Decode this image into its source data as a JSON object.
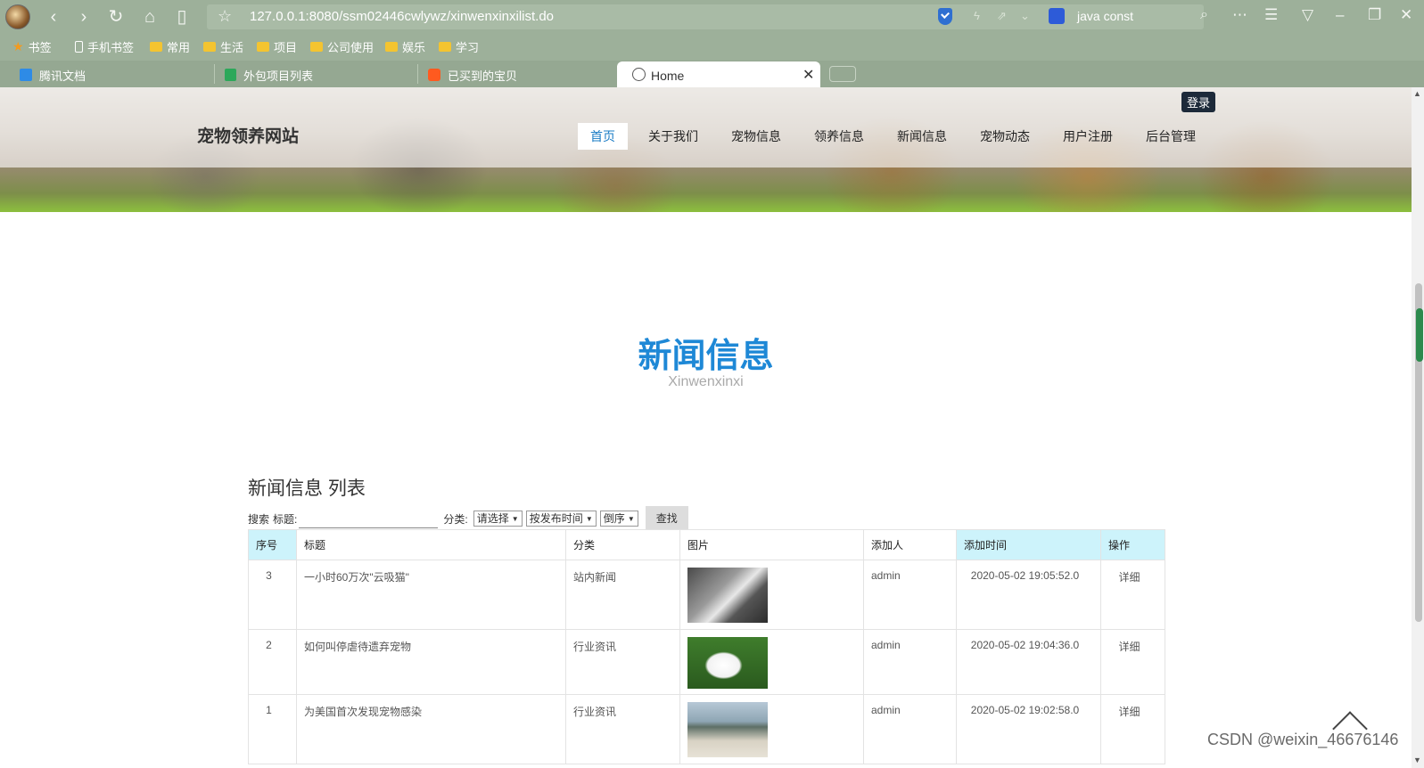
{
  "browser": {
    "url": "127.0.0.1:8080/ssm02446cwlywz/xinwenxinxilist.do",
    "search_text": "java const",
    "bookmarks": [
      "书签",
      "手机书签",
      "常用",
      "生活",
      "项目",
      "公司使用",
      "娱乐",
      "学习"
    ],
    "tabs": [
      "腾讯文档",
      "外包项目列表",
      "已买到的宝贝",
      "Home"
    ]
  },
  "site": {
    "title": "宠物领养网站",
    "login": "登录",
    "nav": [
      "首页",
      "关于我们",
      "宠物信息",
      "领养信息",
      "新闻信息",
      "宠物动态",
      "用户注册",
      "后台管理"
    ]
  },
  "section": {
    "title": "新闻信息",
    "subtitle": "Xinwenxinxi"
  },
  "list": {
    "title": "新闻信息 列表",
    "search_label": "搜索",
    "title_label": "标题:",
    "category_label": "分类:",
    "category_select": "请选择",
    "sort_select": "按发布时间",
    "order_select": "倒序",
    "find_button": "查找",
    "columns": [
      "序号",
      "标题",
      "分类",
      "图片",
      "添加人",
      "添加时间",
      "操作"
    ],
    "rows": [
      {
        "id": "3",
        "title": "一小时60万次\"云吸猫\"",
        "category": "站内新闻",
        "image": "cat-photo",
        "author": "admin",
        "time": "2020-05-02 19:05:52.0",
        "action": "详细"
      },
      {
        "id": "2",
        "title": "如何叫停虐待遗弃宠物",
        "category": "行业资讯",
        "image": "white-dog-photo",
        "author": "admin",
        "time": "2020-05-02 19:04:36.0",
        "action": "详细"
      },
      {
        "id": "1",
        "title": "为美国首次发现宠物感染",
        "category": "行业资讯",
        "image": "beach-dog-photo",
        "author": "admin",
        "time": "2020-05-02 19:02:58.0",
        "action": "详细"
      }
    ]
  },
  "watermark": "CSDN @weixin_46676146"
}
